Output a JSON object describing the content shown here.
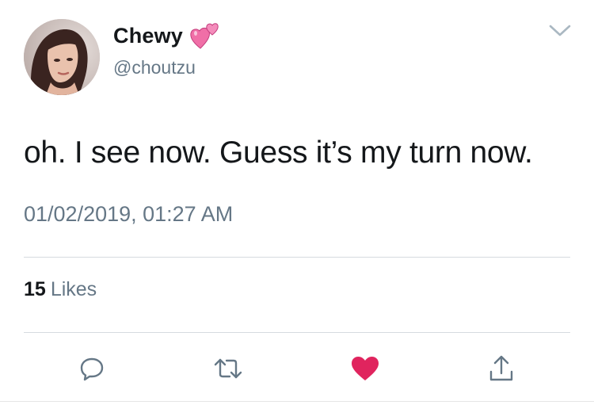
{
  "tweet": {
    "author": {
      "display_name": "Chewy",
      "handle": "@choutzu",
      "name_emoji": "two-hearts-emoji"
    },
    "text": "oh. I see now. Guess it’s my turn now.",
    "timestamp": "01/02/2019, 01:27 AM",
    "stats": {
      "likes_count": "15",
      "likes_label": "Likes"
    },
    "actions": {
      "reply_icon": "reply-icon",
      "retweet_icon": "retweet-icon",
      "like_icon": "heart-icon",
      "like_state": "liked",
      "share_icon": "share-icon"
    }
  },
  "colors": {
    "text_primary": "#14171a",
    "text_secondary": "#657786",
    "divider": "#d6dbe0",
    "like_red": "#e0245e",
    "icon_gray": "#657786"
  }
}
